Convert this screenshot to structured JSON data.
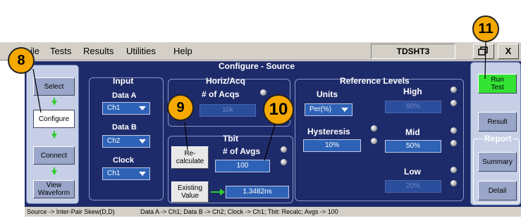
{
  "menubar": {
    "items": [
      "ile",
      "Tests",
      "Results",
      "Utilities",
      "Help"
    ],
    "app_title": "TDSHT3",
    "btn_restore": "",
    "btn_close": "X"
  },
  "panel": {
    "title": "Configure - Source"
  },
  "leftnav": {
    "select": "Select",
    "configure": "Configure",
    "connect": "Connect",
    "view_waveform_l1": "View",
    "view_waveform_l2": "Waveform"
  },
  "input": {
    "title": "Input",
    "data_a_label": "Data A",
    "data_a_value": "Ch1",
    "data_b_label": "Data B",
    "data_b_value": "Ch2",
    "clock_label": "Clock",
    "clock_value": "Ch1"
  },
  "horiz": {
    "title": "Horiz/Acq",
    "acqs_label": "# of Acqs",
    "acqs_value": "10k"
  },
  "tbit": {
    "title": "Tbit",
    "recalc_l1": "Re-",
    "recalc_l2": "calculate",
    "avgs_label": "# of Avgs",
    "avgs_value": "100",
    "existing_l1": "Existing",
    "existing_l2": "Value",
    "existing_result": "1.3482ns"
  },
  "ref": {
    "title": "Reference Levels",
    "units_label": "Units",
    "units_value": "Per(%)",
    "hysteresis_label": "Hysteresis",
    "hysteresis_value": "10%",
    "high_label": "High",
    "high_value": "80%",
    "mid_label": "Mid",
    "mid_value": "50%",
    "low_label": "Low",
    "low_value": "20%"
  },
  "rightnav": {
    "run_l1": "Run",
    "run_l2": "Test",
    "result": "Result",
    "report_title": "Report",
    "summary": "Summary",
    "detail": "Detail"
  },
  "status": {
    "left": "Source -> Inter-Pair Skew(D,D)",
    "right": "Data A -> Ch1; Data B -> Ch2; Clock -> Ch1; Tbit: Recalc; Avgs -> 100"
  },
  "callouts": {
    "c8": "8",
    "c9": "9",
    "c10": "10",
    "c11": "11"
  },
  "colors": {
    "main_bg": "#1e2b6a",
    "accent_callout": "#f5a800",
    "run_green": "#33e233"
  }
}
